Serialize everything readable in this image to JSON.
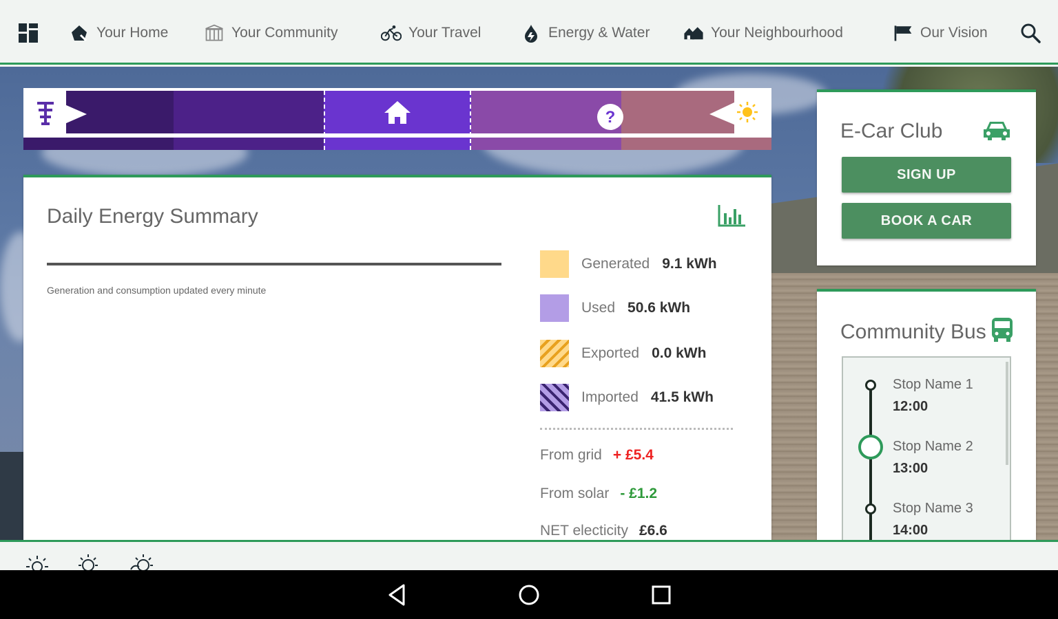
{
  "nav": {
    "items": [
      {
        "label": "Your Home",
        "icon": "home-pencil-icon"
      },
      {
        "label": "Your Community",
        "icon": "community-building-icon"
      },
      {
        "label": "Your Travel",
        "icon": "bicycle-icon"
      },
      {
        "label": "Energy & Water",
        "icon": "energy-water-icon"
      },
      {
        "label": "Your Neighbourhood",
        "icon": "houses-icon"
      },
      {
        "label": "Our Vision",
        "icon": "flag-icon"
      }
    ]
  },
  "colors": {
    "accent": "#2e9a5a",
    "button": "#4c8f60",
    "generated": "#ffd98a",
    "used": "#b39de6",
    "negative": "#e22222",
    "positive": "#2e9a3a"
  },
  "energy": {
    "title": "Daily Energy Summary",
    "note": "Generation and consumption updated every minute",
    "legend": [
      {
        "label": "Generated",
        "value": "9.1 kWh"
      },
      {
        "label": "Used",
        "value": "50.6 kWh"
      },
      {
        "label": "Exported",
        "value": "0.0 kWh"
      },
      {
        "label": "Imported",
        "value": "41.5 kWh"
      }
    ],
    "from_grid_label": "From grid",
    "from_grid_value": "+ £5.4",
    "from_solar_label": "From solar",
    "from_solar_value": "- £1.2",
    "net_label": "NET electicity",
    "net_value": "£6.6"
  },
  "ecar": {
    "title": "E-Car Club",
    "signup_label": "SIGN UP",
    "book_label": "BOOK A CAR"
  },
  "bus": {
    "title": "Community Bus",
    "stops": [
      {
        "name": "Stop Name 1",
        "time": "12:00"
      },
      {
        "name": "Stop Name 2",
        "time": "13:00"
      },
      {
        "name": "Stop Name 3",
        "time": "14:00"
      }
    ]
  }
}
